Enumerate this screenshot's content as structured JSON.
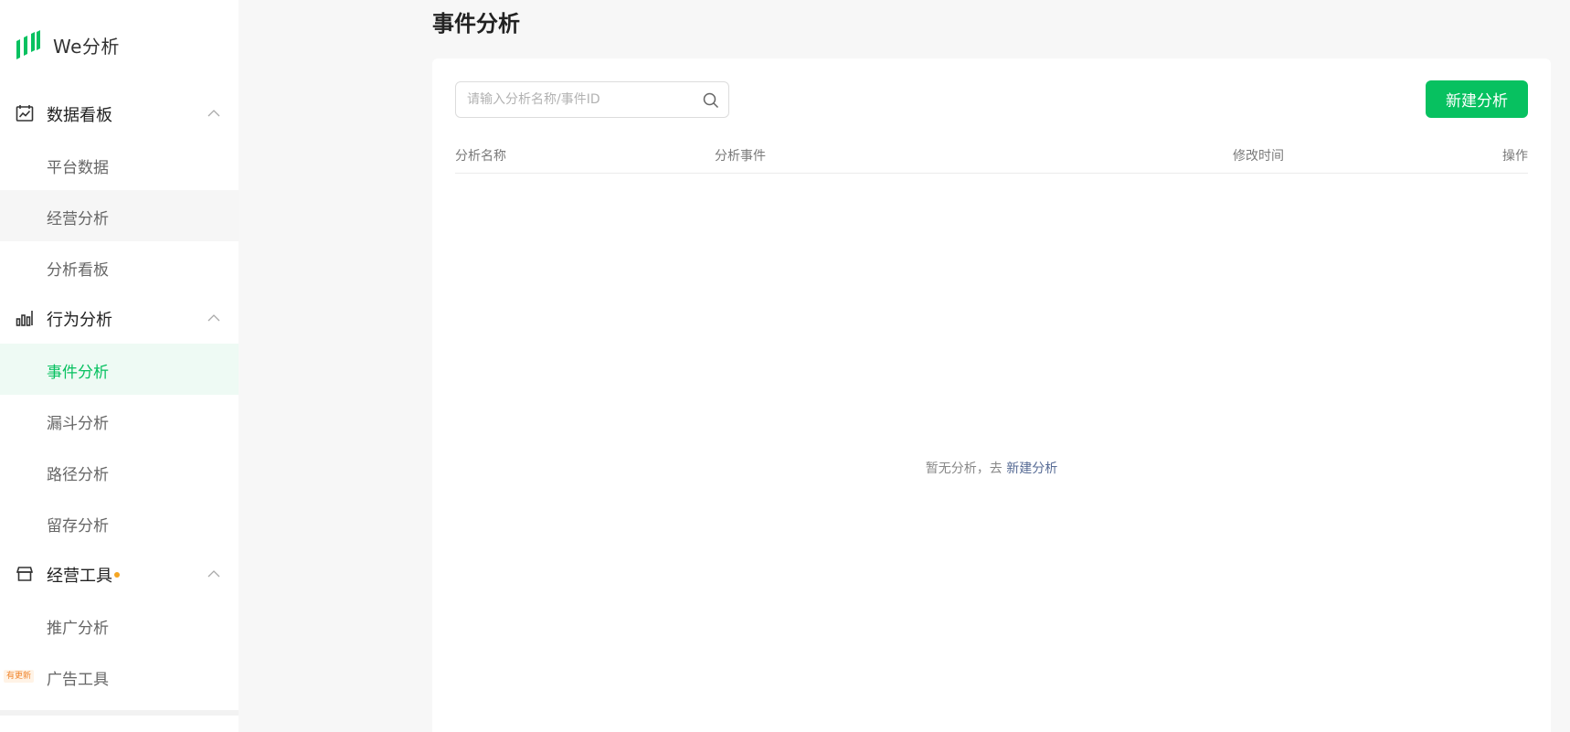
{
  "app": {
    "name": "We分析"
  },
  "sidebar": {
    "groups": [
      {
        "label": "数据看板",
        "icon": "chart-board-icon",
        "items": [
          {
            "label": "平台数据"
          },
          {
            "label": "经营分析"
          },
          {
            "label": "分析看板"
          }
        ]
      },
      {
        "label": "行为分析",
        "icon": "bar-chart-icon",
        "items": [
          {
            "label": "事件分析",
            "active": true
          },
          {
            "label": "漏斗分析"
          },
          {
            "label": "路径分析"
          },
          {
            "label": "留存分析"
          }
        ]
      },
      {
        "label": "经营工具",
        "icon": "store-icon",
        "has_dot": true,
        "items": [
          {
            "label": "推广分析"
          },
          {
            "label": "广告工具",
            "badge": "有更新"
          }
        ]
      }
    ]
  },
  "page": {
    "title": "事件分析"
  },
  "search": {
    "placeholder": "请输入分析名称/事件ID",
    "value": ""
  },
  "toolbar": {
    "new_label": "新建分析"
  },
  "table": {
    "columns": [
      "分析名称",
      "分析事件",
      "修改时间",
      "操作"
    ],
    "rows": []
  },
  "empty_state": {
    "text": "暂无分析，去",
    "link": "新建分析"
  },
  "colors": {
    "accent": "#07c160",
    "link": "#576b95",
    "dot": "#f5a623"
  }
}
